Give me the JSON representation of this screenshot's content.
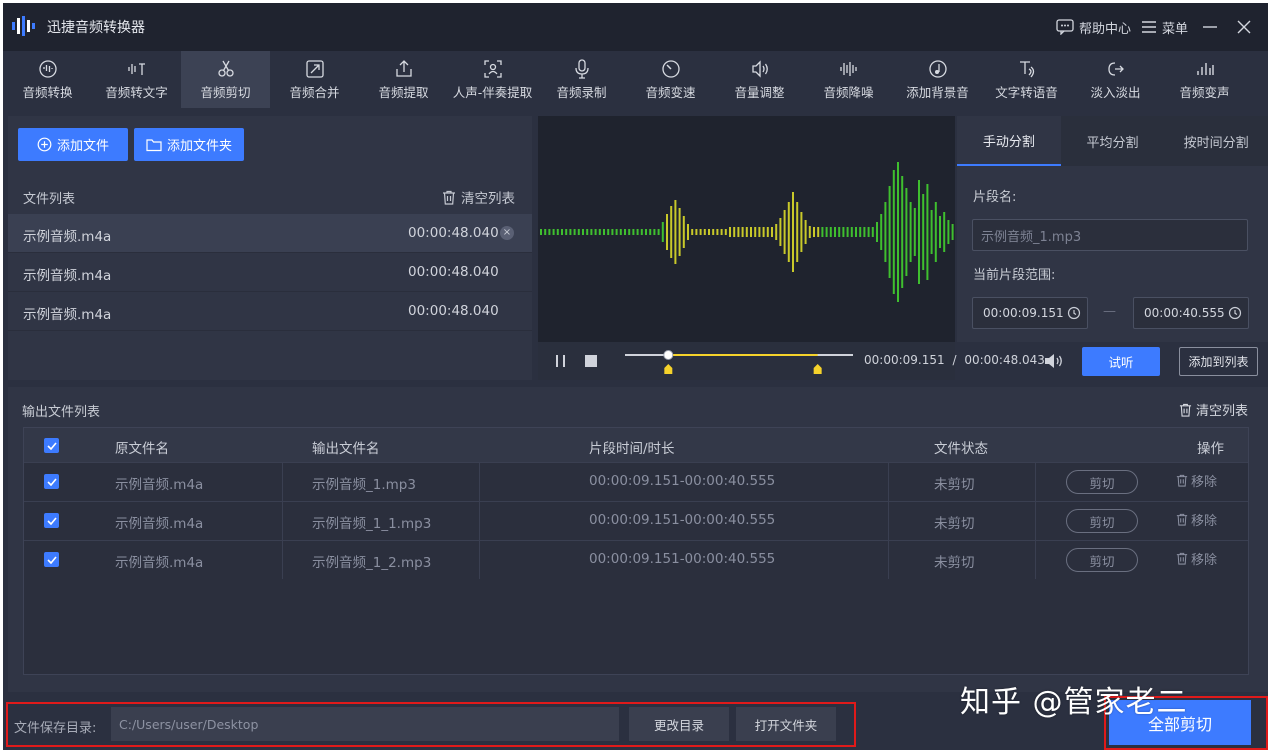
{
  "app": {
    "title": "迅捷音频转换器"
  },
  "titlebar": {
    "help_label": "帮助中心",
    "menu_label": "菜单"
  },
  "toolbar": {
    "items": [
      {
        "label": "音频转换",
        "icon": "audio-convert-icon"
      },
      {
        "label": "音频转文字",
        "icon": "audio-to-text-icon"
      },
      {
        "label": "音频剪切",
        "icon": "scissors-icon",
        "active": true
      },
      {
        "label": "音频合并",
        "icon": "merge-icon"
      },
      {
        "label": "音频提取",
        "icon": "extract-icon"
      },
      {
        "label": "人声-伴奏提取",
        "icon": "vocal-extract-icon"
      },
      {
        "label": "音频录制",
        "icon": "microphone-icon"
      },
      {
        "label": "音频变速",
        "icon": "speed-icon"
      },
      {
        "label": "音量调整",
        "icon": "volume-icon"
      },
      {
        "label": "音频降噪",
        "icon": "denoise-icon"
      },
      {
        "label": "添加背景音",
        "icon": "background-music-icon"
      },
      {
        "label": "文字转语音",
        "icon": "text-to-speech-icon"
      },
      {
        "label": "淡入淡出",
        "icon": "fade-icon"
      },
      {
        "label": "音频变声",
        "icon": "voice-change-icon"
      }
    ]
  },
  "files": {
    "add_file_label": "添加文件",
    "add_folder_label": "添加文件夹",
    "list_title": "文件列表",
    "clear_label": "清空列表",
    "rows": [
      {
        "name": "示例音频.m4a",
        "duration": "00:00:48.040"
      },
      {
        "name": "示例音频.m4a",
        "duration": "00:00:48.040"
      },
      {
        "name": "示例音频.m4a",
        "duration": "00:00:48.040"
      }
    ]
  },
  "player": {
    "current_time": "00:00:09.151",
    "separator": "/",
    "total_time": "00:00:48.043",
    "selection_start_fraction": 0.19,
    "selection_end_fraction": 0.845,
    "playhead_fraction": 0.19
  },
  "split": {
    "tabs": [
      "手动分割",
      "平均分割",
      "按时间分割"
    ],
    "segment_name_label": "片段名:",
    "segment_name_placeholder": "示例音频_1.mp3",
    "range_label": "当前片段范围:",
    "range_start": "00:00:09.151",
    "range_dash": "—",
    "range_end": "00:00:40.555",
    "preview_label": "试听",
    "add_to_list_label": "添加到列表"
  },
  "output": {
    "title": "输出文件列表",
    "clear_label": "清空列表",
    "headers": {
      "source": "原文件名",
      "output": "输出文件名",
      "range": "片段时间/时长",
      "status": "文件状态",
      "action": "操作"
    },
    "rows": [
      {
        "source": "示例音频.m4a",
        "output": "示例音频_1.mp3",
        "range": "00:00:09.151-00:00:40.555",
        "status": "未剪切",
        "cut": "剪切",
        "remove": "移除"
      },
      {
        "source": "示例音频.m4a",
        "output": "示例音频_1_1.mp3",
        "range": "00:00:09.151-00:00:40.555",
        "status": "未剪切",
        "cut": "剪切",
        "remove": "移除"
      },
      {
        "source": "示例音频.m4a",
        "output": "示例音频_1_2.mp3",
        "range": "00:00:09.151-00:00:40.555",
        "status": "未剪切",
        "cut": "剪切",
        "remove": "移除"
      }
    ]
  },
  "bottom": {
    "save_dir_label": "文件保存目录:",
    "save_dir_value": "C:/Users/user/Desktop",
    "change_dir_label": "更改目录",
    "open_folder_label": "打开文件夹",
    "cut_all_label": "全部剪切"
  },
  "watermark": "知乎 @管家老二",
  "colors": {
    "accent": "#3d7bff",
    "selection": "#f5d22b",
    "highlight_frame": "#e01a1a",
    "wave_green": "#3fbf2f",
    "wave_yellow": "#c9c92a"
  }
}
